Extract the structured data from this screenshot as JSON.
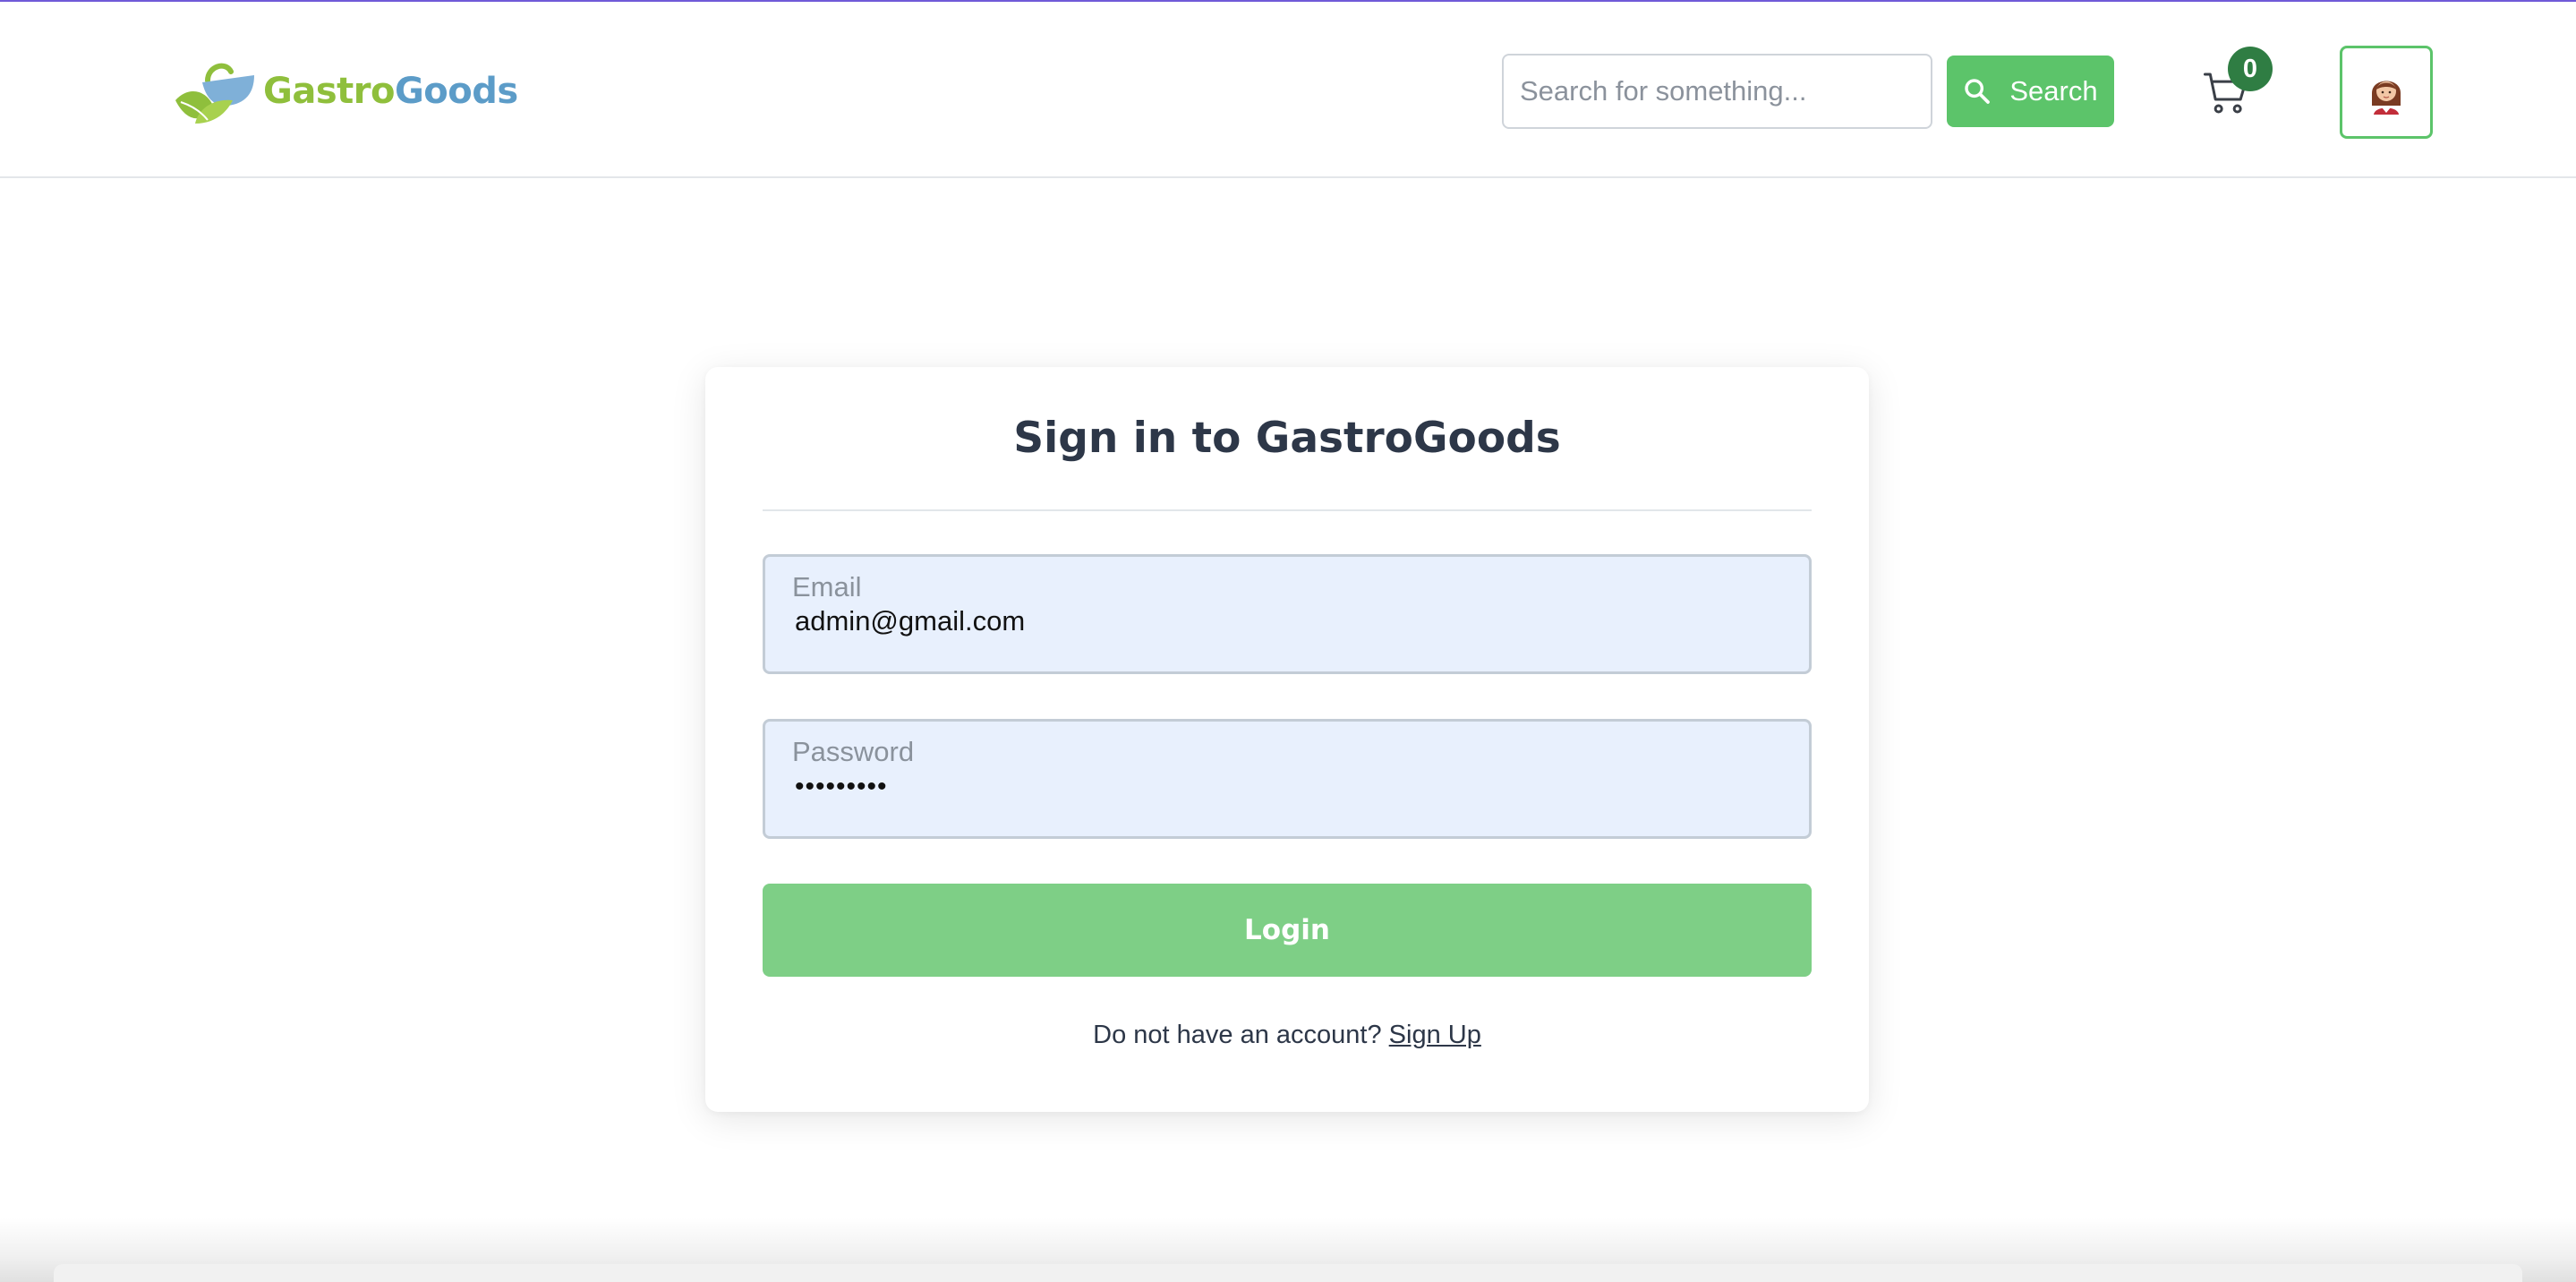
{
  "header": {
    "logo_part1": "Gastro",
    "logo_part2": "Goods",
    "search_placeholder": "Search for something...",
    "search_button_label": "Search",
    "cart_count": "0",
    "accent_color": "#5cc46a"
  },
  "login": {
    "title": "Sign in to GastroGoods",
    "email_label": "Email",
    "email_value": "admin@gmail.com",
    "password_label": "Password",
    "password_value": "•••••••••",
    "login_button_label": "Login",
    "signup_prompt": "Do not have an account?",
    "signup_link": "Sign Up"
  },
  "icons": [
    "logo-icon",
    "search-icon",
    "cart-icon",
    "avatar-icon"
  ]
}
